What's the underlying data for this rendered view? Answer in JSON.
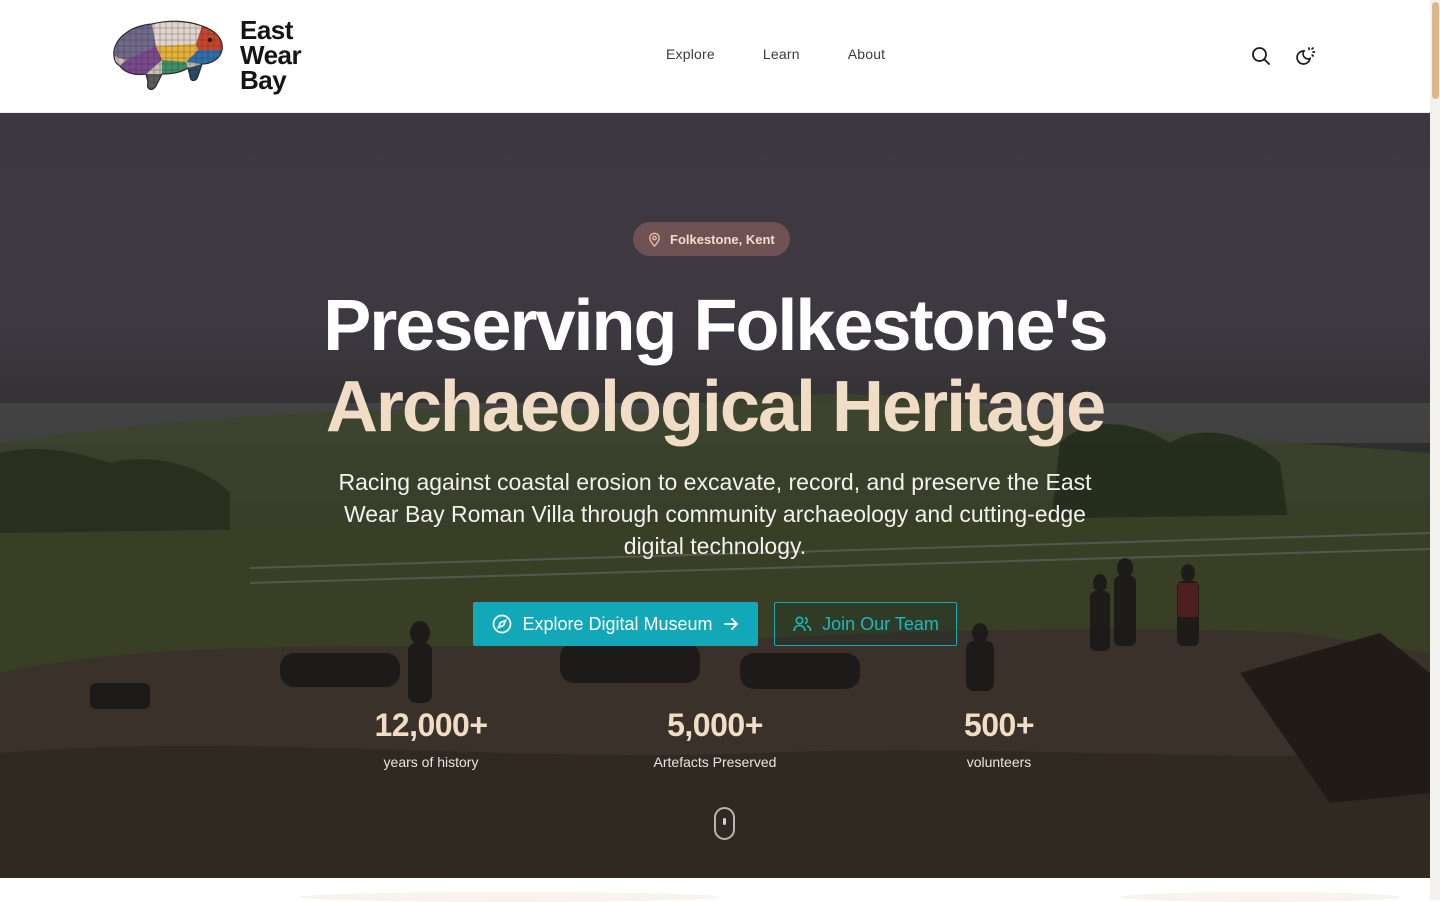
{
  "header": {
    "logo": {
      "line1": "East",
      "line2": "Wear",
      "line3": "Bay",
      "icon": "mosaic-boar-logo"
    },
    "nav": [
      {
        "label": "Explore"
      },
      {
        "label": "Learn"
      },
      {
        "label": "About"
      }
    ],
    "icons": {
      "search": "search-icon",
      "theme": "theme-toggle-icon"
    }
  },
  "hero": {
    "badge": {
      "icon": "map-pin-icon",
      "label": "Folkestone, Kent"
    },
    "title_line1": "Preserving Folkestone's",
    "title_line2": "Archaeological Heritage",
    "subtitle": "Racing against coastal erosion to excavate, record, and preserve the East Wear Bay Roman Villa through community archaeology and cutting-edge digital technology.",
    "buttons": {
      "primary": {
        "label": "Explore Digital Museum",
        "icon": "compass-icon",
        "trailing_icon": "arrow-right-icon"
      },
      "secondary": {
        "label": "Join Our Team",
        "icon": "users-icon"
      }
    },
    "stats": [
      {
        "value": "12,000+",
        "label": "years of history"
      },
      {
        "value": "5,000+",
        "label": "Artefacts Preserved"
      },
      {
        "value": "500+",
        "label": "volunteers"
      }
    ],
    "scroll_indicator": "mouse-scroll-icon"
  },
  "colors": {
    "accent": "#12a8b8",
    "highlight": "#f1ddc6",
    "badge_bg": "#b07870"
  }
}
